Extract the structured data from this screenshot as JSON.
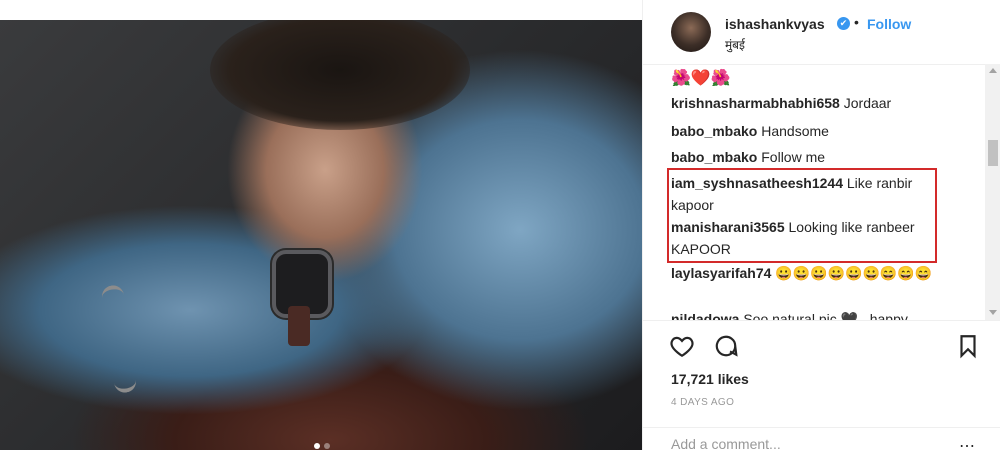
{
  "post": {
    "carousel": {
      "count": 2,
      "active": 1
    }
  },
  "header": {
    "username": "ishashankvyas",
    "verified_mark": "✔",
    "separator": "•",
    "follow_label": "Follow",
    "location": "मुंबई"
  },
  "comments": {
    "emoji_line": "🌺❤️🌺",
    "items": [
      {
        "user": "krishnasharmabhabhi658",
        "text": "Jordaar"
      },
      {
        "user": "babo_mbako",
        "text": "Handsome"
      },
      {
        "user": "babo_mbako",
        "text": "Follow me"
      },
      {
        "user": "iam_syshnasatheesh1244",
        "text": "Like ranbir kapoor"
      },
      {
        "user": "manisharani3565",
        "text": "Looking like ranbeer KAPOOR"
      },
      {
        "user": "laylasyarifah74",
        "text": "😀😀😀😀😀😀😄😄😄"
      },
      {
        "user": "nildadowa",
        "text": "Soo natural pic 🖤 . happy"
      }
    ],
    "highlight_color": "#d32a2a"
  },
  "actions": {
    "icons": [
      "heart-icon",
      "comment-icon",
      "bookmark-icon"
    ],
    "likes": "17,721 likes",
    "time_ago": "4 DAYS AGO",
    "add_comment_placeholder": "Add a comment...",
    "more_label": "⋯"
  },
  "colors": {
    "accent": "#3897f0",
    "text": "#262626",
    "muted": "#999999"
  }
}
